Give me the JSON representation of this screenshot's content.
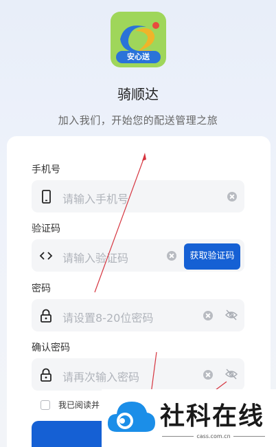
{
  "header": {
    "logo_badge": "安心送",
    "app_name": "骑顺达",
    "subtitle": "加入我们，开始您的配送管理之旅"
  },
  "form": {
    "phone": {
      "label": "手机号",
      "placeholder": "请输入手机号"
    },
    "code": {
      "label": "验证码",
      "placeholder": "请输入验证码",
      "button": "获取验证码"
    },
    "password": {
      "label": "密码",
      "placeholder": "请设置8-20位密码"
    },
    "confirm": {
      "label": "确认密码",
      "placeholder": "请再次输入密码"
    },
    "agreement": "我已阅读并"
  },
  "watermark": {
    "title": "社科在线",
    "url": "cass.com.cn"
  },
  "colors": {
    "primary": "#1560d4",
    "field_bg": "#f4f5f7",
    "annotation": "#d6343f"
  },
  "icons": [
    "phone-icon",
    "code-icon",
    "lock-icon",
    "clear-icon",
    "eye-off-icon"
  ]
}
